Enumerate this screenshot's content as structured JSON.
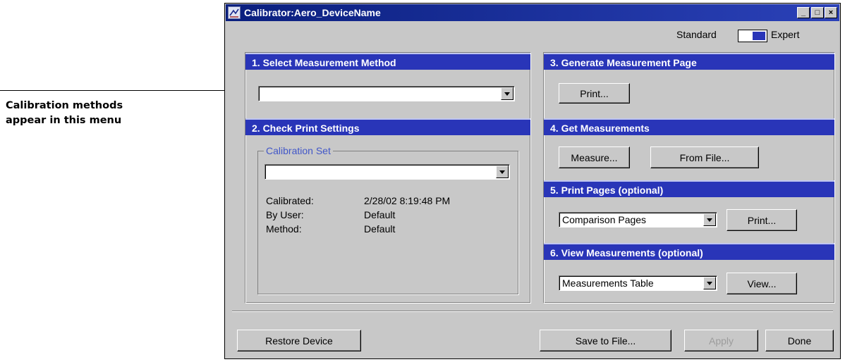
{
  "callout": {
    "line1": "Calibration methods",
    "line2": "appear in this menu"
  },
  "window": {
    "title": "Calibrator:Aero_DeviceName",
    "controls": {
      "minimize": "_",
      "maximize": "□",
      "close": "×"
    }
  },
  "mode": {
    "standard_label": "Standard",
    "expert_label": "Expert",
    "selected": "Expert"
  },
  "sections": {
    "s1": {
      "title": "1. Select Measurement Method",
      "method_value": ""
    },
    "s2": {
      "title": "2. Check Print Settings",
      "group_label": "Calibration Set",
      "set_value": "",
      "rows": [
        {
          "label": "Calibrated:",
          "value": "2/28/02 8:19:48 PM"
        },
        {
          "label": "By User:",
          "value": "Default"
        },
        {
          "label": "Method:",
          "value": "Default"
        }
      ]
    },
    "s3": {
      "title": "3. Generate Measurement Page",
      "print_label": "Print..."
    },
    "s4": {
      "title": "4. Get Measurements",
      "measure_label": "Measure...",
      "from_file_label": "From File..."
    },
    "s5": {
      "title": "5. Print Pages (optional)",
      "select_value": "Comparison Pages",
      "print_label": "Print..."
    },
    "s6": {
      "title": "6. View Measurements (optional)",
      "select_value": "Measurements Table",
      "view_label": "View..."
    }
  },
  "footer": {
    "restore_label": "Restore Device",
    "save_label": "Save to File...",
    "apply_label": "Apply",
    "done_label": "Done"
  },
  "colors": {
    "title_bar": "#0a1f7e",
    "section_header": "#2935b8",
    "window_bg": "#c8c8c8",
    "group_label": "#4257c8"
  }
}
